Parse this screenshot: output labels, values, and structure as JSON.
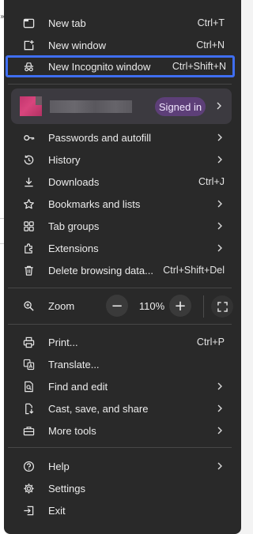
{
  "background": {
    "arrow_glyph": "»"
  },
  "menu": {
    "group1": [
      {
        "id": "new-tab",
        "label": "New tab",
        "shortcut": "Ctrl+T",
        "icon": "new-tab-icon"
      },
      {
        "id": "new-window",
        "label": "New window",
        "shortcut": "Ctrl+N",
        "icon": "new-window-icon"
      },
      {
        "id": "new-incognito-window",
        "label": "New Incognito window",
        "shortcut": "Ctrl+Shift+N",
        "icon": "incognito-icon",
        "focused": true
      }
    ],
    "profile": {
      "status": "Signed in",
      "avatar_color": "#c3356e"
    },
    "group2": [
      {
        "id": "passwords-and-autofill",
        "label": "Passwords and autofill",
        "icon": "key-icon",
        "submenu": true
      },
      {
        "id": "history",
        "label": "History",
        "icon": "history-icon",
        "submenu": true
      },
      {
        "id": "downloads",
        "label": "Downloads",
        "shortcut": "Ctrl+J",
        "icon": "download-icon"
      },
      {
        "id": "bookmarks-and-lists",
        "label": "Bookmarks and lists",
        "icon": "star-icon",
        "submenu": true
      },
      {
        "id": "tab-groups",
        "label": "Tab groups",
        "icon": "tab-groups-icon",
        "submenu": true
      },
      {
        "id": "extensions",
        "label": "Extensions",
        "icon": "puzzle-icon",
        "submenu": true
      },
      {
        "id": "delete-browsing-data",
        "label": "Delete browsing data...",
        "shortcut": "Ctrl+Shift+Del",
        "icon": "trash-icon"
      }
    ],
    "zoom": {
      "label": "Zoom",
      "value": "110%",
      "minus": "−",
      "plus": "+"
    },
    "group3": [
      {
        "id": "print",
        "label": "Print...",
        "shortcut": "Ctrl+P",
        "icon": "printer-icon"
      },
      {
        "id": "translate",
        "label": "Translate...",
        "icon": "translate-icon"
      },
      {
        "id": "find-and-edit",
        "label": "Find and edit",
        "icon": "find-icon",
        "submenu": true
      },
      {
        "id": "cast-save-share",
        "label": "Cast, save, and share",
        "icon": "cast-save-icon",
        "submenu": true
      },
      {
        "id": "more-tools",
        "label": "More tools",
        "icon": "toolbox-icon",
        "submenu": true
      }
    ],
    "group4": [
      {
        "id": "help",
        "label": "Help",
        "icon": "help-icon",
        "submenu": true
      },
      {
        "id": "settings",
        "label": "Settings",
        "icon": "gear-icon"
      },
      {
        "id": "exit",
        "label": "Exit",
        "icon": "exit-icon"
      }
    ]
  },
  "colors": {
    "menu_bg": "#292929",
    "focus_ring": "#3f6ef1",
    "signed_in_bg": "#5d3f78",
    "profile_card_bg": "#3c3a40"
  }
}
